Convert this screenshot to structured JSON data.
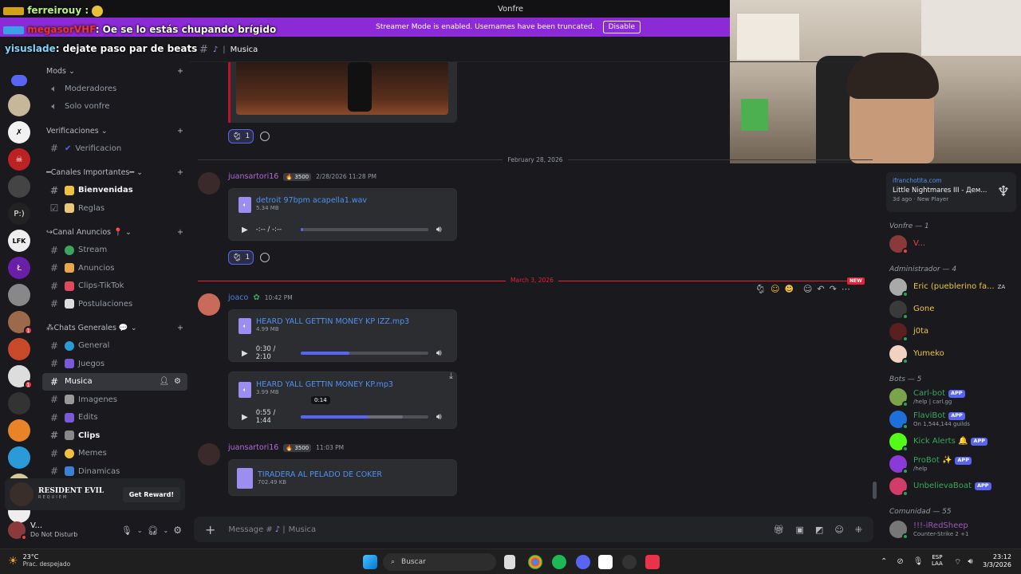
{
  "window": {
    "title": "Vonfre"
  },
  "streamer_banner": {
    "text": "Streamer Mode is enabled. Usernames have been truncated.",
    "button": "Disable"
  },
  "overlay_chat": [
    {
      "user": "ferreirouy :",
      "text": ""
    },
    {
      "user": "megasorVHF",
      "text": ": Oe se lo estás chupando brígido"
    },
    {
      "user": "yisuslade",
      "text": ": dejate paso par de beats"
    }
  ],
  "channel_header": {
    "name": "Musica"
  },
  "sidebar": {
    "categories": [
      {
        "name": "Mods",
        "channels": [
          {
            "name": "Moderadores",
            "type": "voice"
          },
          {
            "name": "Solo vonfre",
            "type": "voice"
          }
        ]
      },
      {
        "name": "Verificaciones",
        "channels": [
          {
            "name": "Verificacion",
            "type": "text"
          }
        ]
      },
      {
        "name": "━Canales Importantes━",
        "channels": [
          {
            "name": "Bienvenidas",
            "type": "text",
            "bold": true
          },
          {
            "name": "Reglas",
            "type": "rules"
          }
        ]
      },
      {
        "name": "↪Canal Anuncios",
        "channels": [
          {
            "name": "Stream",
            "type": "text"
          },
          {
            "name": "Anuncios",
            "type": "text"
          },
          {
            "name": "Clips-TikTok",
            "type": "text"
          },
          {
            "name": "Postulaciones",
            "type": "text"
          }
        ]
      },
      {
        "name": "⁂Chats Generales",
        "channels": [
          {
            "name": "General",
            "type": "text"
          },
          {
            "name": "Juegos",
            "type": "text"
          },
          {
            "name": "Musica",
            "type": "text",
            "selected": true
          },
          {
            "name": "Imagenes",
            "type": "text"
          },
          {
            "name": "Edits",
            "type": "text"
          },
          {
            "name": "Clips",
            "type": "text",
            "bold": true
          },
          {
            "name": "Memes",
            "type": "text"
          },
          {
            "name": "Dinamicas",
            "type": "text"
          }
        ]
      }
    ],
    "promo": {
      "title": "RESIDENT EVIL",
      "subtitle": "REQUIEM",
      "button": "Get Reward!"
    },
    "user": {
      "name": "V...",
      "status": "Do Not Disturb"
    }
  },
  "messages": {
    "reaction_count": "1",
    "date1": "February 28, 2026",
    "date2": "March 3, 2026",
    "new_badge": "NEW",
    "m1": {
      "user": "juansartori16",
      "badge": "3500",
      "time": "2/28/2026 11:28 PM",
      "file": {
        "name": "detroit 97bpm acapella1.wav",
        "size": "5.34 MB",
        "time": "-:-- / -:--"
      }
    },
    "m2": {
      "user": "joaco",
      "time": "10:42 PM",
      "file1": {
        "name": "HEARD YALL GETTIN MONEY KP IZZ.mp3",
        "size": "4.99 MB",
        "time": "0:30 / 2:10",
        "progress": 0.38
      },
      "file2": {
        "name": "HEARD YALL GETTIN MONEY KP.mp3",
        "size": "3.99 MB",
        "time": "0:55 / 1:44",
        "tooltip": "0:14",
        "progress": 0.53
      }
    },
    "m3": {
      "user": "juansartori16",
      "badge": "3500",
      "time": "11:03 PM",
      "file": {
        "name": "TIRADERA AL PELADO DE COKER",
        "size": "702.49 KB"
      }
    }
  },
  "input": {
    "placeholder": "Message #",
    "channel": "Musica"
  },
  "members": {
    "activity": {
      "user": "ifranchotita.com",
      "game": "Little Nightmares III - Дем...",
      "detail": "3d ago",
      "tag": "New Player"
    },
    "groups": [
      {
        "name": "Vonfre — 1",
        "members": [
          {
            "name": "V...",
            "color": "#ed4245",
            "av": "#8a3a3a",
            "status": "#ed4245"
          }
        ]
      },
      {
        "name": "Administrador — 4",
        "members": [
          {
            "name": "Eric (pueblerino fa...",
            "color": "#e6c54b",
            "av": "#a9a9a9",
            "status": "#23a55a",
            "tag": "ZA"
          },
          {
            "name": "Gone",
            "color": "#e6c54b",
            "av": "#3a3a3a",
            "status": "#23a55a"
          },
          {
            "name": "j0ta",
            "color": "#e6c54b",
            "av": "#5a1f1f",
            "status": "#23a55a"
          },
          {
            "name": "Yumeko",
            "color": "#e6c54b",
            "av": "#f0d2c0",
            "status": "#23a55a"
          }
        ]
      },
      {
        "name": "Bots — 5",
        "members": [
          {
            "name": "Carl-bot",
            "color": "#3ba55c",
            "av": "#7aa34a",
            "status": "#23a55a",
            "app": "APP",
            "sub": "/help | carl.gg"
          },
          {
            "name": "FlaviBot",
            "color": "#3ba55c",
            "av": "#1e6fd9",
            "status": "#23a55a",
            "app": "APP",
            "sub": "On 1,544,144 guilds"
          },
          {
            "name": "Kick Alerts 🔔",
            "color": "#3ba55c",
            "av": "#53fc18",
            "status": "#23a55a",
            "app": "APP"
          },
          {
            "name": "ProBot ✨",
            "color": "#3ba55c",
            "av": "#8a3ad6",
            "status": "#23a55a",
            "app": "APP",
            "sub": "/help"
          },
          {
            "name": "UnbelievaBoat",
            "color": "#3ba55c",
            "av": "#d13c6a",
            "status": "#23a55a",
            "app": "APP"
          }
        ]
      },
      {
        "name": "Comunidad — 55",
        "members": [
          {
            "name": "!!!-iRedSheep",
            "color": "#9b59b6",
            "av": "#777777",
            "status": "#23a55a",
            "sub": "Counter-Strike 2 +1"
          }
        ]
      }
    ]
  },
  "taskbar": {
    "weather_temp": "23°C",
    "weather_desc": "Prac. despejado",
    "search": "Buscar",
    "lang1": "ESP",
    "lang2": "LAA",
    "time": "23:12",
    "date": "3/3/2026"
  },
  "colors": {
    "accent": "#5865f2",
    "streamer": "#8b2ad6",
    "link": "#4f92ef"
  }
}
